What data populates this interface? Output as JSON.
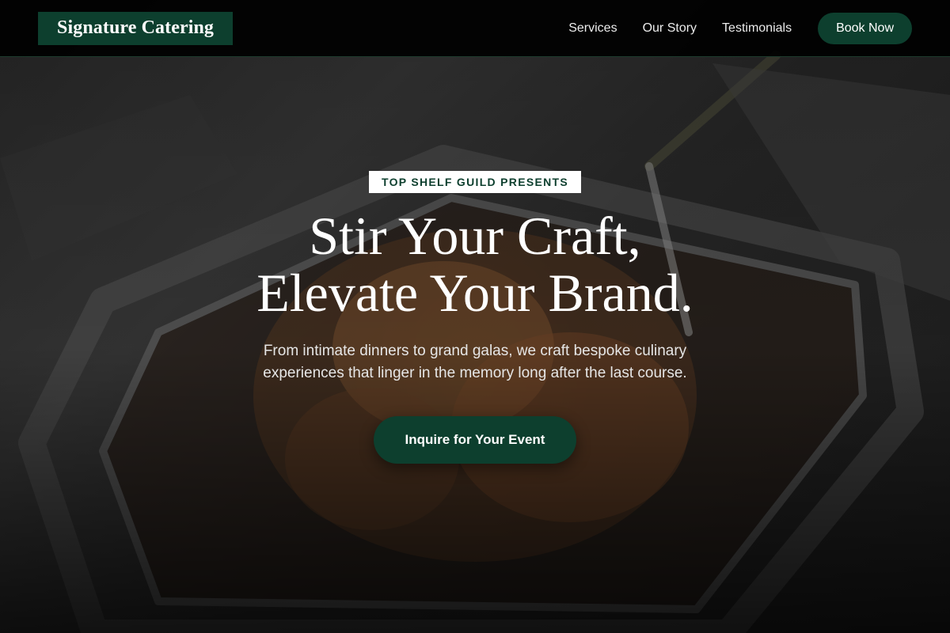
{
  "header": {
    "logo": "Signature Catering",
    "nav": [
      {
        "label": "Services"
      },
      {
        "label": "Our Story"
      },
      {
        "label": "Testimonials"
      }
    ],
    "book_button": "Book Now"
  },
  "hero": {
    "eyebrow": "TOP SHELF GUILD PRESENTS",
    "headline_line1": "Stir Your Craft,",
    "headline_line2": "Elevate Your Brand.",
    "subcopy": "From intimate dinners to grand galas, we craft bespoke culinary experiences that linger in the memory long after the last course.",
    "cta": "Inquire for Your Event",
    "background_image": "catering-food-tray-photo"
  },
  "colors": {
    "brand_green": "#0d3f2e",
    "header_bg": "#000000",
    "text_light": "#ffffff"
  }
}
